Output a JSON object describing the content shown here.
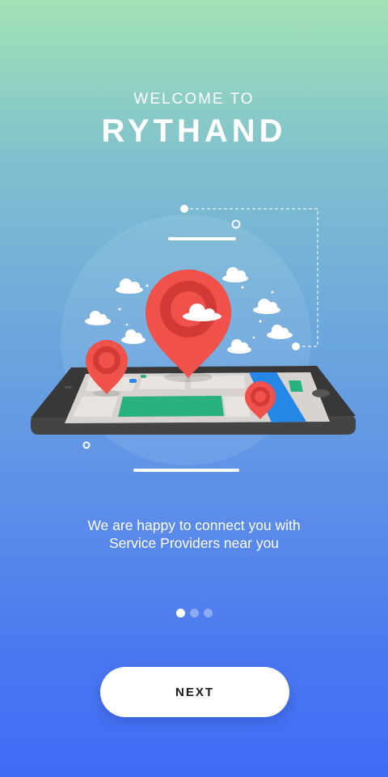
{
  "onboarding": {
    "welcome_text": "WELCOME TO",
    "app_name": "RYTHAND",
    "tagline_line1": "We are happy to connect you with",
    "tagline_line2": "Service Providers near you",
    "next_label": "NEXT",
    "page_indicator": {
      "total": 3,
      "current": 1
    }
  },
  "colors": {
    "gradient_top": "#a2e2b5",
    "gradient_bottom": "#3f6cf7",
    "pin_red": "#f0514b",
    "phone_dark": "#3a3a3a",
    "button_bg": "#ffffff"
  }
}
